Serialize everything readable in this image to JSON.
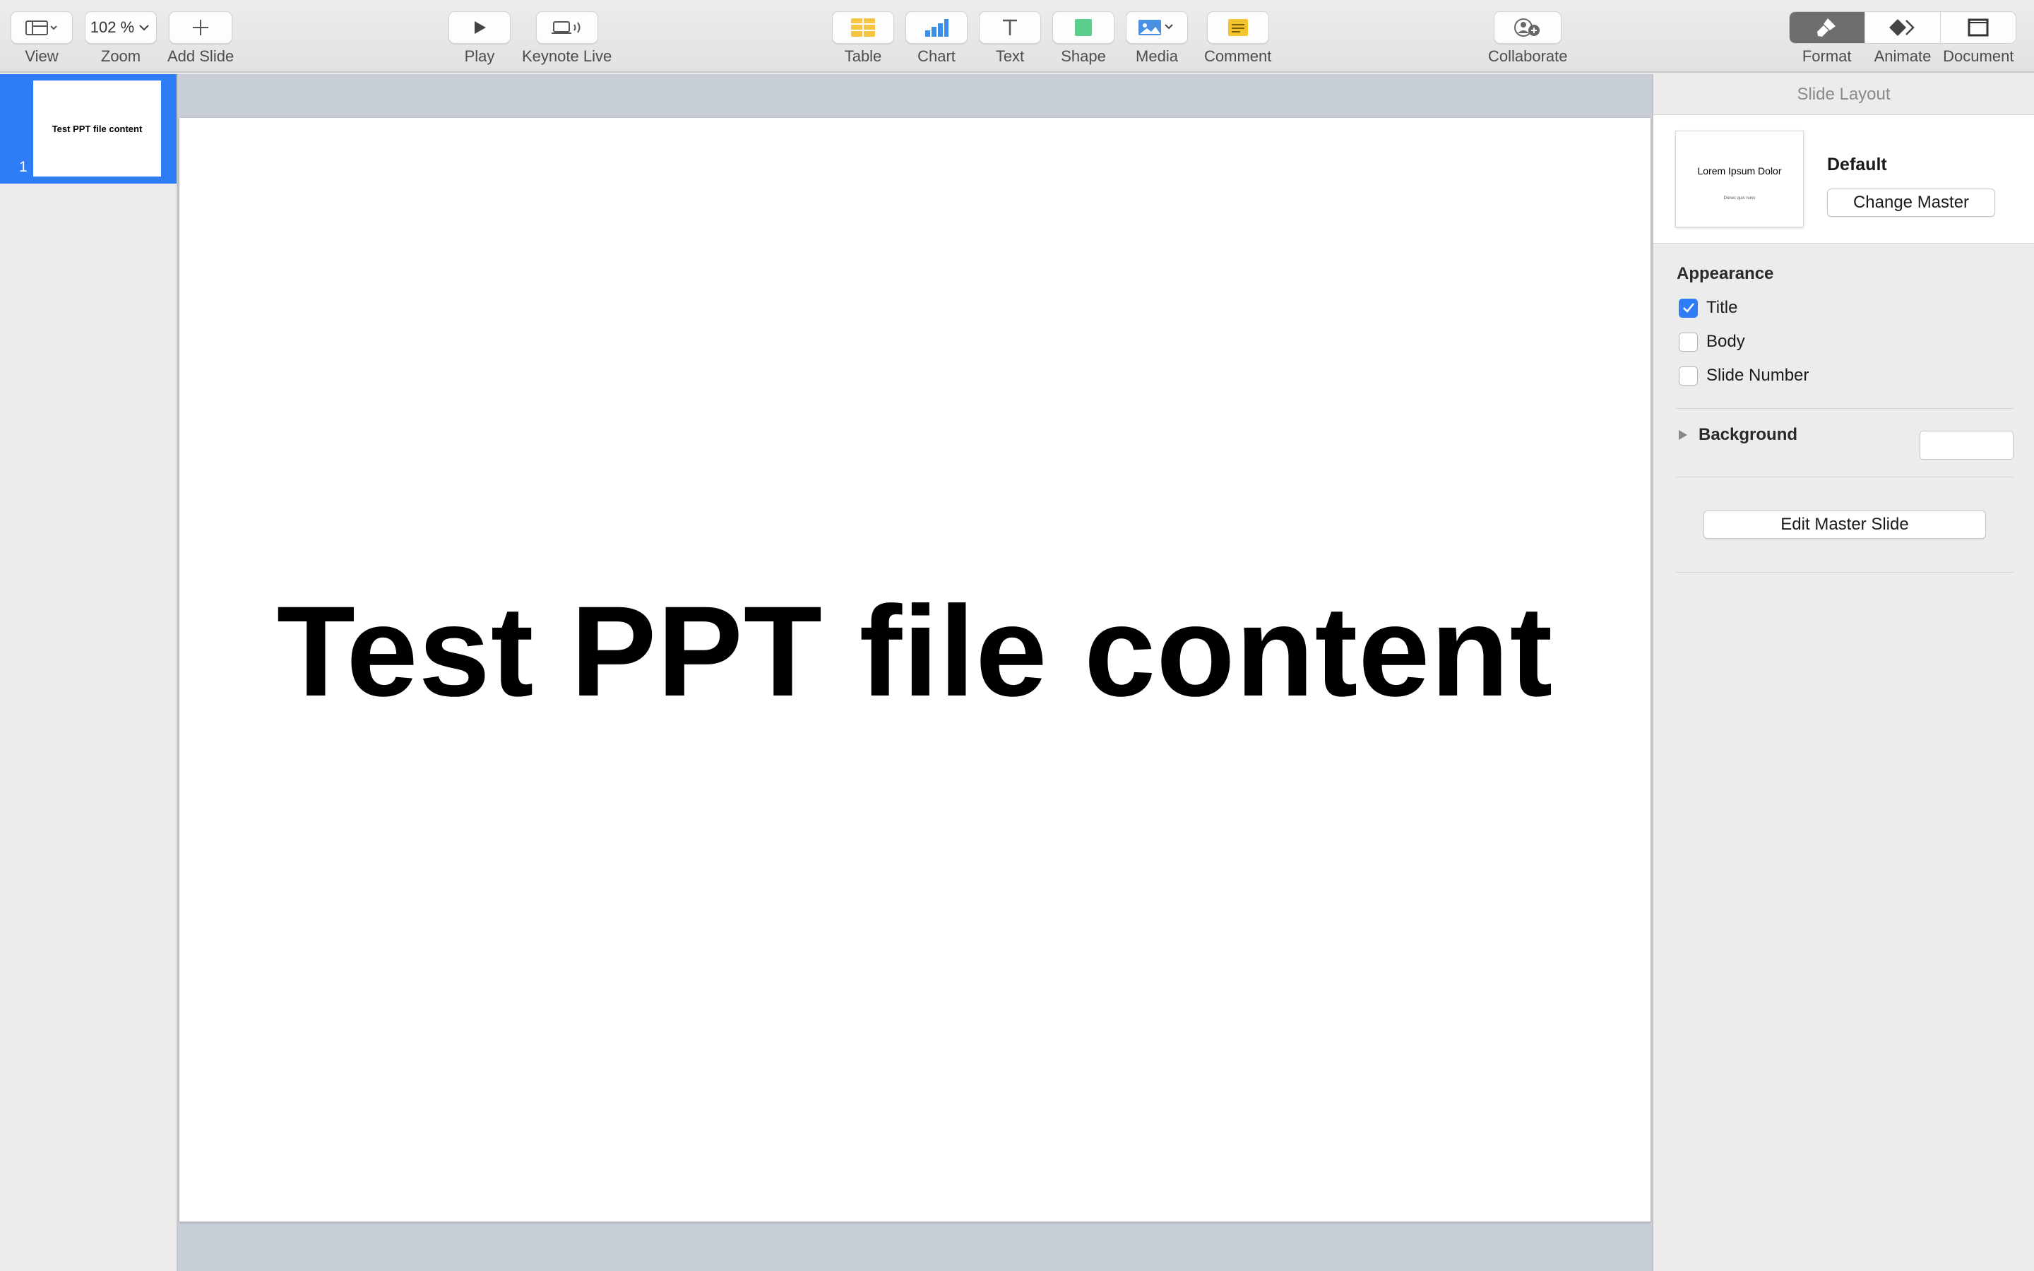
{
  "toolbar": {
    "view": {
      "label": "View",
      "icon": "sidebar-view-icon"
    },
    "zoom": {
      "label": "Zoom",
      "value": "102 %"
    },
    "add_slide": {
      "label": "Add Slide",
      "icon": "plus-icon"
    },
    "play": {
      "label": "Play",
      "icon": "play-icon"
    },
    "keynote_live": {
      "label": "Keynote Live",
      "icon": "keynote-live-icon"
    },
    "table": {
      "label": "Table",
      "icon": "table-icon",
      "color": "#f5c542"
    },
    "chart": {
      "label": "Chart",
      "icon": "chart-icon",
      "color": "#3a8ee6"
    },
    "text": {
      "label": "Text",
      "icon": "text-icon"
    },
    "shape": {
      "label": "Shape",
      "icon": "shape-icon",
      "color": "#5ccf8c"
    },
    "media": {
      "label": "Media",
      "icon": "media-icon",
      "color": "#4a90e2"
    },
    "comment": {
      "label": "Comment",
      "icon": "comment-icon",
      "color": "#f4c430"
    },
    "collaborate": {
      "label": "Collaborate",
      "icon": "collaborate-icon"
    },
    "format": {
      "label": "Format",
      "icon": "paintbrush-icon",
      "active": true
    },
    "animate": {
      "label": "Animate",
      "icon": "animate-diamond-icon"
    },
    "document": {
      "label": "Document",
      "icon": "document-icon"
    }
  },
  "navigator": {
    "slides": [
      {
        "number": "1",
        "title": "Test PPT file content",
        "selected": true
      }
    ]
  },
  "canvas": {
    "slide_title": "Test PPT file content"
  },
  "inspector": {
    "header": "Slide Layout",
    "master": {
      "thumb_title": "Lorem Ipsum Dolor",
      "thumb_subtitle": "Donec quis nunc",
      "name": "Default",
      "change_button": "Change Master"
    },
    "appearance": {
      "title": "Appearance",
      "options": [
        {
          "label": "Title",
          "checked": true
        },
        {
          "label": "Body",
          "checked": false
        },
        {
          "label": "Slide Number",
          "checked": false
        }
      ]
    },
    "background": {
      "label": "Background",
      "color": "#ffffff"
    },
    "edit_master_button": "Edit Master Slide"
  },
  "colors": {
    "accent": "#2e7cf6",
    "canvas_bg": "#c8ced6",
    "active_segment": "#6e6e6e"
  }
}
